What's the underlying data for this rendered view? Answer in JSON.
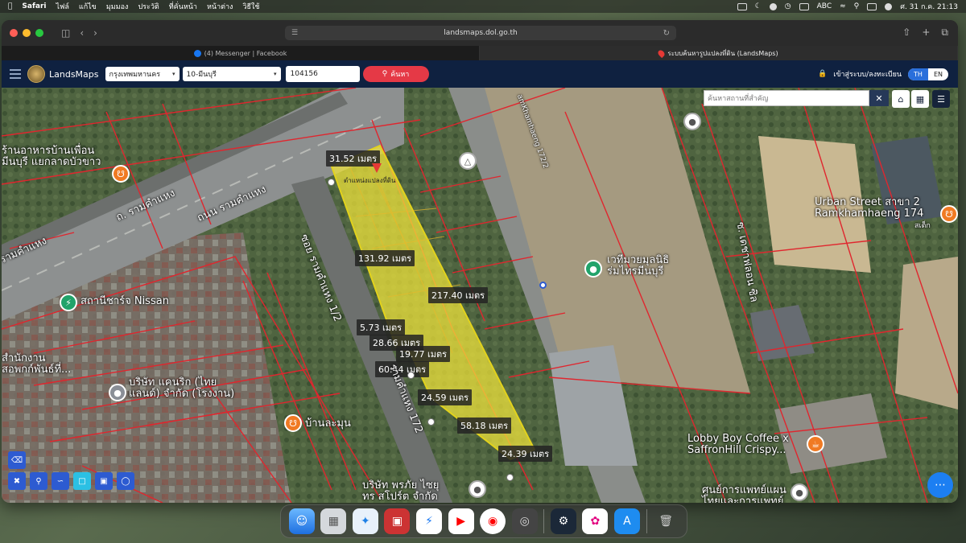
{
  "menubar": {
    "app": "Safari",
    "menus": [
      "ไฟล์",
      "แก้ไข",
      "มุมมอง",
      "ประวัติ",
      "ที่คั่นหน้า",
      "หน้าต่าง",
      "วิธีใช้"
    ],
    "input_source": "ABC",
    "clock": "ศ. 31 ก.ค.  21:13"
  },
  "browser": {
    "url": "landsmaps.dol.go.th",
    "tabs": [
      {
        "label": "(4) Messenger | Facebook",
        "icon": "facebook-icon"
      },
      {
        "label": "ระบบค้นหารูปแปลงที่ดิน (LandsMaps)",
        "icon": "map-pin-icon"
      }
    ]
  },
  "header": {
    "brand": "LandsMaps",
    "province": "กรุงเทพมหานคร",
    "district": "10-มีนบุรี",
    "parcel_no": "104156",
    "search_label": "ค้นหา",
    "login_label": "เข้าสู่ระบบ/ลงทะเบียน",
    "lang_th": "TH",
    "lang_en": "EN"
  },
  "map": {
    "search_placeholder": "ค้นหาสถานที่สำคัญ",
    "measurements": [
      "31.52 เมตร",
      "131.92 เมตร",
      "217.40 เมตร",
      "5.73 เมตร",
      "28.66 เมตร",
      "19.77 เมตร",
      "60.44 เมตร",
      "24.59 เมตร",
      "58.18 เมตร",
      "24.39 เมตร"
    ],
    "labels": {
      "restaurant": "ร้านอาหารบ้านเพื่อน\nมีนบุรี แยกลาดบัวขาว",
      "road1": "ถ. รามคำแหง",
      "road2": "ถนน รามคำแหง",
      "road3": "รามคำแหง",
      "soi": "ซอย รามคำแหง 1/2",
      "soi2": "รามคำแหง 172",
      "road_en": "amKhamhaeng 172/2",
      "parcel_tag": "ตำแหน่งแปลงที่ดิน",
      "charger": "สถานีชาร์จ Nissan",
      "office": "สำนักงาน\nสอพกก์พันธ์ที่...",
      "company": "บริษัท แคนริก (ไทย\nแลนด์) จำกัด (โรงงาน)",
      "banlamun": "บ้านละมุน",
      "company2": "บริษัท พรภัย ไซยุ\nทร สโปร์ต จำกัด",
      "temple": "เวทีมวยมุลนิธิ\nร่มไทรมีนบุรี",
      "urban": "Urban Street สาขา 2\nRamkhamhaeng 174",
      "urban_sub": "สเต็ก",
      "soi_sat": "ซ. เดชาฟลอน ซิล",
      "lobby": "Lobby Boy Coffee x\nSaffronHill Crispy...",
      "clinic": "ศูนย์การแพทย์แผน\nไทยและการแพทย์"
    }
  },
  "dock": {
    "apps": [
      "finder-icon",
      "launchpad-icon",
      "safari-icon",
      "photo-booth-icon",
      "messenger-icon",
      "youtube-icon",
      "youtube-music-icon",
      "disk-utility-icon",
      "steam-icon",
      "photos-icon",
      "app-store-icon",
      "trash-icon"
    ]
  }
}
